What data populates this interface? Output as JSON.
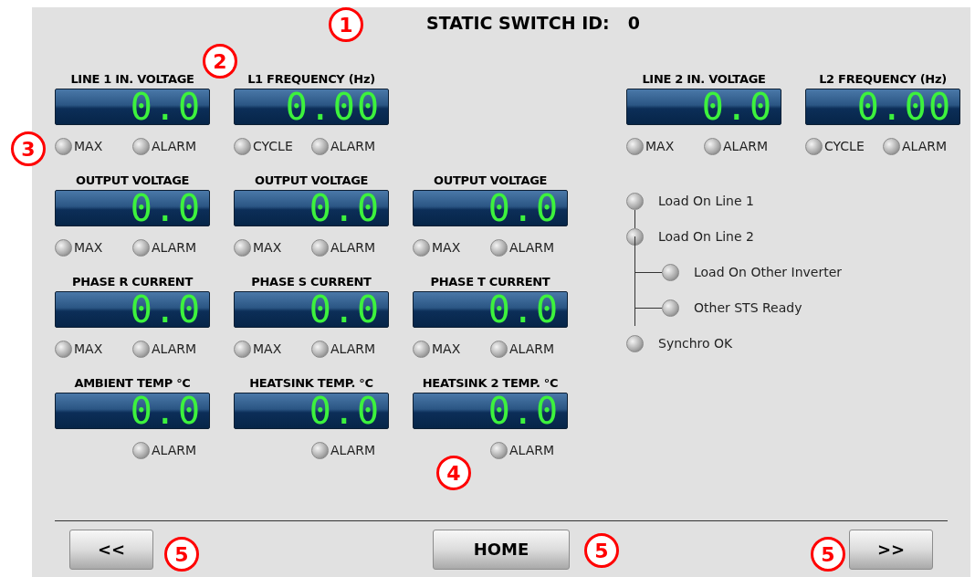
{
  "title": {
    "label": "STATIC SWITCH ID:",
    "value": "0"
  },
  "left_rows": [
    [
      {
        "label": "LINE 1 IN. VOLTAGE",
        "value": "0.0",
        "indicators": [
          {
            "label": "MAX",
            "on": false
          },
          {
            "label": "ALARM",
            "on": false
          }
        ]
      },
      {
        "label": "L1 FREQUENCY (Hz)",
        "value": "0.00",
        "indicators": [
          {
            "label": "CYCLE",
            "on": false
          },
          {
            "label": "ALARM",
            "on": false
          }
        ]
      }
    ],
    [
      {
        "label": "OUTPUT VOLTAGE",
        "value": "0.0",
        "indicators": [
          {
            "label": "MAX",
            "on": false
          },
          {
            "label": "ALARM",
            "on": false
          }
        ]
      },
      {
        "label": "OUTPUT VOLTAGE",
        "value": "0.0",
        "indicators": [
          {
            "label": "MAX",
            "on": false
          },
          {
            "label": "ALARM",
            "on": false
          }
        ]
      },
      {
        "label": "OUTPUT VOLTAGE",
        "value": "0.0",
        "indicators": [
          {
            "label": "MAX",
            "on": false
          },
          {
            "label": "ALARM",
            "on": false
          }
        ]
      }
    ],
    [
      {
        "label": "PHASE R CURRENT",
        "value": "0.0",
        "indicators": [
          {
            "label": "MAX",
            "on": false
          },
          {
            "label": "ALARM",
            "on": false
          }
        ]
      },
      {
        "label": "PHASE S CURRENT",
        "value": "0.0",
        "indicators": [
          {
            "label": "MAX",
            "on": false
          },
          {
            "label": "ALARM",
            "on": false
          }
        ]
      },
      {
        "label": "PHASE T CURRENT",
        "value": "0.0",
        "indicators": [
          {
            "label": "MAX",
            "on": false
          },
          {
            "label": "ALARM",
            "on": false
          }
        ]
      }
    ],
    [
      {
        "label": "AMBIENT TEMP °C",
        "value": "0.0",
        "indicators": [
          {
            "label": "ALARM",
            "on": false
          }
        ]
      },
      {
        "label": "HEATSINK TEMP. °C",
        "value": "0.0",
        "indicators": [
          {
            "label": "ALARM",
            "on": false
          }
        ]
      },
      {
        "label": "HEATSINK 2 TEMP. °C",
        "value": "0.0",
        "indicators": [
          {
            "label": "ALARM",
            "on": false
          }
        ]
      }
    ]
  ],
  "right_gauges": [
    {
      "label": "LINE 2 IN. VOLTAGE",
      "value": "0.0",
      "indicators": [
        {
          "label": "MAX",
          "on": false
        },
        {
          "label": "ALARM",
          "on": false
        }
      ]
    },
    {
      "label": "L2 FREQUENCY (Hz)",
      "value": "0.00",
      "indicators": [
        {
          "label": "CYCLE",
          "on": false
        },
        {
          "label": "ALARM",
          "on": false
        }
      ]
    }
  ],
  "status": [
    {
      "label": "Load On Line 1",
      "on": false
    },
    {
      "label": "Load On Line 2",
      "on": false,
      "children": [
        {
          "label": "Load On Other Inverter",
          "on": false
        },
        {
          "label": "Other STS Ready",
          "on": false
        }
      ]
    },
    {
      "label": "Synchro OK",
      "on": false
    }
  ],
  "buttons": [
    "<<",
    "HOME",
    ">>"
  ],
  "callouts": [
    "1",
    "2",
    "3",
    "4",
    "5",
    "5",
    "5"
  ]
}
